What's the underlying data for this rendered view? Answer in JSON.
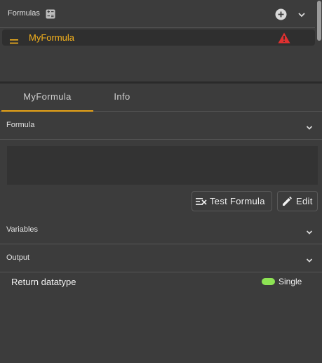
{
  "formulas_panel": {
    "title": "Formulas",
    "title_icon": "calculator-icon",
    "add_icon": "plus-circle-icon",
    "collapse_icon": "chevron-down-icon",
    "items": [
      {
        "name": "MyFormula",
        "drag_icon": "drag-handle-icon",
        "status_icon": "warning-icon",
        "name_color": "#f5b21d",
        "status_color": "#e03030"
      }
    ]
  },
  "tabs": [
    {
      "label": "MyFormula",
      "active": true
    },
    {
      "label": "Info",
      "active": false
    }
  ],
  "sections": {
    "formula": {
      "label": "Formula",
      "expanded": true,
      "editor_value": ""
    },
    "variables": {
      "label": "Variables",
      "expanded": false
    },
    "output": {
      "label": "Output",
      "expanded": true
    }
  },
  "buttons": {
    "test_formula": {
      "label": "Test Formula",
      "icon": "test-formula-icon"
    },
    "edit": {
      "label": "Edit",
      "icon": "pencil-icon"
    }
  },
  "output": {
    "return_datatype_label": "Return datatype",
    "datatype": "Single",
    "datatype_color": "#8de354"
  },
  "colors": {
    "accent": "#e8a317",
    "background": "#3c3c3c",
    "row_selected": "#2f2f2f"
  }
}
